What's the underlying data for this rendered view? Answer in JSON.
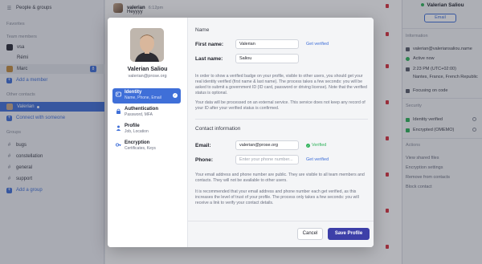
{
  "sidebar": {
    "people_groups": "People & groups",
    "favorites": "Favorites",
    "team_members": "Team members",
    "members": [
      "vsa",
      "Rémi",
      "Marc"
    ],
    "marc_badge": "8",
    "add_member": "Add a member",
    "other_contacts": "Other contacts",
    "contacts": [
      "Valerian"
    ],
    "connect": "Connect with someone",
    "groups": "Groups",
    "group_items": [
      "bugs",
      "constellation",
      "general",
      "support"
    ],
    "add_group": "Add a group"
  },
  "chat": {
    "author": "valerian",
    "time": "6:12pm",
    "text": "Heyyyy"
  },
  "right": {
    "name": "Valerian Saliou",
    "email_btn": "Email",
    "information": "Information",
    "email": "valerian@valeriansaliou.name",
    "status": "Active now",
    "time": "2:23 PM (UTC+02:00)",
    "location": "Nantes, France, French Republic",
    "activity": "Focusing on code",
    "security": "Security",
    "identity": "Identity verified",
    "encrypted": "Encrypted (OMEMO)",
    "actions": "Actions",
    "view_files": "View shared files",
    "encryption": "Encryption settings",
    "remove": "Remove from contacts",
    "block": "Block contact"
  },
  "modal": {
    "name": "Valerian Saliou",
    "email": "valerian@prose.org",
    "nav": [
      {
        "title": "Identity",
        "sub": "Name, Phone, Email"
      },
      {
        "title": "Authentication",
        "sub": "Password, MFA"
      },
      {
        "title": "Profile",
        "sub": "Job, Location"
      },
      {
        "title": "Encryption",
        "sub": "Certificates, Keys"
      }
    ],
    "name_section": "Name",
    "first_name_label": "First name:",
    "first_name_value": "Valerian",
    "last_name_label": "Last name:",
    "last_name_value": "Saliou",
    "get_verified": "Get verified",
    "name_para1": "In order to show a verified badge on your profile, visible to other users, you should get your real identity verified (first name & last name). The process takes a few seconds: you will be asked to submit a government ID (ID card, password or driving license). Note that the verified status is optional.",
    "name_para2": "Your data will be processed on an external service. This service does not keep any record of your ID after your verified status is confirmed.",
    "contact_section": "Contact information",
    "email_label": "Email:",
    "email_value": "valerian@prose.org",
    "verified": "Verified",
    "phone_label": "Phone:",
    "phone_placeholder": "Enter your phone number...",
    "phone_get_verified": "Get verified",
    "contact_para1": "Your email address and phone number are public. They are visible to all team members and contacts. They will not be available to other users.",
    "contact_para2": "It is recommended that your email address and phone number each get verified, as this increases the level of trust of your profile. The process only takes a few seconds: you will receive a link to verify your contact details.",
    "cancel": "Cancel",
    "save": "Save Profile"
  }
}
